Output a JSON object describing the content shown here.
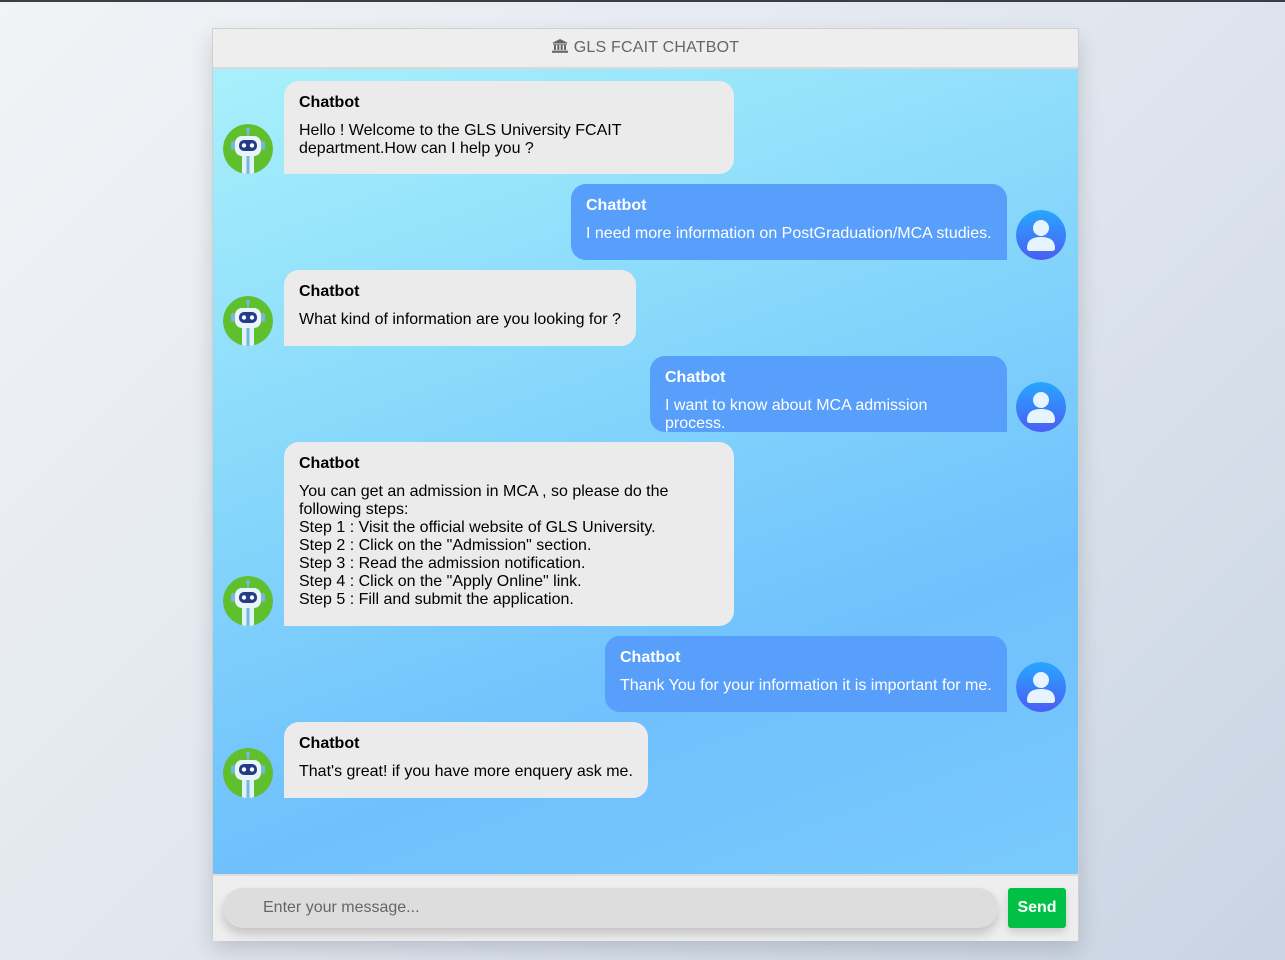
{
  "header": {
    "title": "GLS FCAIT CHATBOT",
    "icon": "bank-icon"
  },
  "colors": {
    "bot_bubble": "#ebebeb",
    "user_bubble": "#579ffb",
    "send_button": "#00c145"
  },
  "messages": [
    {
      "sender": "bot",
      "name": "Chatbot",
      "text": "Hello ! Welcome to the GLS University FCAIT\ndepartment.How can I help you ?"
    },
    {
      "sender": "user",
      "name": "Chatbot",
      "text": "I need more information on PostGraduation/MCA studies."
    },
    {
      "sender": "bot",
      "name": "Chatbot",
      "text": "What kind of information are you looking for ?"
    },
    {
      "sender": "user",
      "name": "Chatbot",
      "text": "I want to know about MCA admission process."
    },
    {
      "sender": "bot",
      "name": "Chatbot",
      "text": "You can get an admission in MCA , so please do the\nfollowing steps:\nStep 1 : Visit the official website of GLS University.\nStep 2 : Click on the \"Admission\" section.\nStep 3 : Read the admission notification.\nStep 4 : Click on the \"Apply Online\" link.\nStep 5 : Fill and submit the application."
    },
    {
      "sender": "user",
      "name": "Chatbot",
      "text": "Thank You for your information it is important for me."
    },
    {
      "sender": "bot",
      "name": "Chatbot",
      "text": "That's great! if you have more enquery ask me."
    }
  ],
  "input": {
    "placeholder": "Enter your message...",
    "value": ""
  },
  "send_label": "Send"
}
